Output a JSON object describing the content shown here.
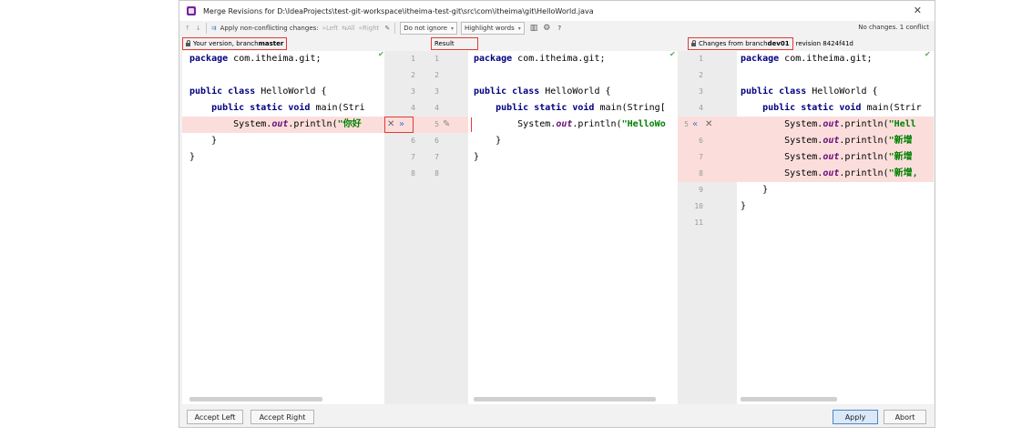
{
  "window": {
    "title": "Merge Revisions for D:\\IdeaProjects\\test-git-workspace\\itheima-test-git\\src\\com\\itheima\\git\\HelloWorld.java"
  },
  "toolbar": {
    "apply_non_conflicting": "Apply non-conflicting changes:",
    "left": "Left",
    "all": "All",
    "right": "Right",
    "ignore_combo": "Do not ignore",
    "highlight_combo": "Highlight words",
    "help": "?",
    "status": "No changes. 1 conflict"
  },
  "headers": {
    "left_prefix": "Your version, branch ",
    "left_branch": "master",
    "center": "Result",
    "right_prefix": "Changes from branch ",
    "right_branch": "dev01",
    "right_revision": "revision 8424f41d"
  },
  "left_code": {
    "l1a": "package",
    "l1b": " com.itheima.git;",
    "l3a": "public class",
    "l3b": " HelloWorld {",
    "l4a": "    public static void",
    "l4b": " main(Stri",
    "l5a": "        System.",
    "l5b": "out",
    "l5c": ".println(",
    "l5d": "\"你好",
    "l6": "    }",
    "l7": "}"
  },
  "center_code": {
    "l1a": "package",
    "l1b": " com.itheima.git;",
    "l3a": "public class",
    "l3b": " HelloWorld {",
    "l4a": "    public static void",
    "l4b": " main(String[",
    "l5a": "        System.",
    "l5b": "out",
    "l5c": ".println(",
    "l5d": "\"HelloWo",
    "l6": "    }",
    "l7": "}"
  },
  "right_code": {
    "l1a": "package",
    "l1b": " com.itheima.git;",
    "l3a": "public class",
    "l3b": " HelloWorld {",
    "l4a": "    public static void",
    "l4b": " main(Strir",
    "l5a": "        System.",
    "l5b": "out",
    "l5c": ".println(",
    "l5d": "\"Hell",
    "l6a": "        System.",
    "l6b": "out",
    "l6c": ".println(",
    "l6d": "\"新增",
    "l7a": "        System.",
    "l7b": "out",
    "l7c": ".println(",
    "l7d": "\"新增",
    "l8a": "        System.",
    "l8b": "out",
    "l8c": ".println(",
    "l8d": "\"新增,",
    "l9": "    }",
    "l10": "}"
  },
  "line_numbers": {
    "n1": "1",
    "n2": "2",
    "n3": "3",
    "n4": "4",
    "n5": "5",
    "n6": "6",
    "n7": "7",
    "n8": "8",
    "n9": "9",
    "n10": "10",
    "n11": "11"
  },
  "buttons": {
    "accept_left": "Accept Left",
    "accept_right": "Accept Right",
    "apply": "Apply",
    "abort": "Abort"
  },
  "colors": {
    "conflict_bg": "#fbdedb",
    "highlight_box": "#e53935"
  }
}
